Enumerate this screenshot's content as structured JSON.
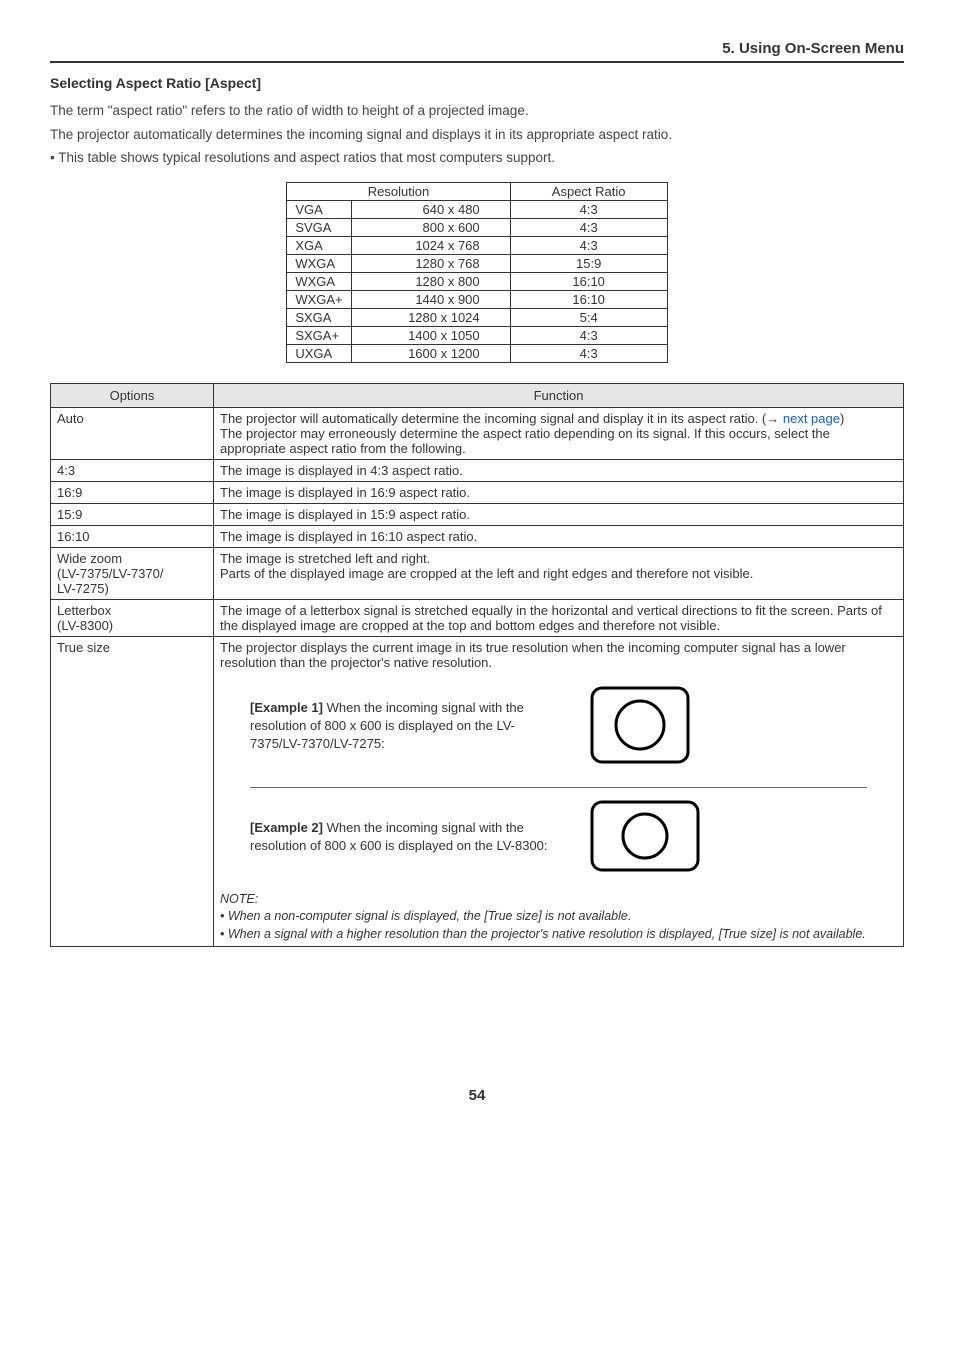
{
  "header": {
    "section": "5. Using On-Screen Menu"
  },
  "heading": "Selecting Aspect Ratio [Aspect]",
  "intro": {
    "p1": "The term \"aspect ratio\" refers to the ratio of width to height of a projected image.",
    "p2": "The projector automatically determines the incoming signal and displays it in its appropriate aspect ratio.",
    "p3": "• This table shows typical resolutions and aspect ratios that most computers support."
  },
  "resTable": {
    "head": {
      "res": "Resolution",
      "ar": "Aspect Ratio"
    },
    "rows": [
      {
        "code": "VGA",
        "res": "640 x 480",
        "ar": "4:3"
      },
      {
        "code": "SVGA",
        "res": "800 x 600",
        "ar": "4:3"
      },
      {
        "code": "XGA",
        "res": "1024 x 768",
        "ar": "4:3"
      },
      {
        "code": "WXGA",
        "res": "1280 x 768",
        "ar": "15:9"
      },
      {
        "code": "WXGA",
        "res": "1280 x 800",
        "ar": "16:10"
      },
      {
        "code": "WXGA+",
        "res": "1440 x 900",
        "ar": "16:10"
      },
      {
        "code": "SXGA",
        "res": "1280 x 1024",
        "ar": "5:4"
      },
      {
        "code": "SXGA+",
        "res": "1400 x 1050",
        "ar": "4:3"
      },
      {
        "code": "UXGA",
        "res": "1600 x 1200",
        "ar": "4:3"
      }
    ]
  },
  "optsTable": {
    "head": {
      "opt": "Options",
      "fn": "Function"
    },
    "auto": {
      "label": "Auto",
      "p1a": "The projector will automatically determine the incoming signal and display it in its aspect ratio. (→ ",
      "link": "next page",
      "p1b": ")",
      "p2": "The projector may erroneously determine the aspect ratio depending on its signal. If this occurs, select the appropriate aspect ratio from the following."
    },
    "r43": {
      "label": "4:3",
      "fn": "The image is displayed in 4:3 aspect ratio."
    },
    "r169": {
      "label": "16:9",
      "fn": "The image is displayed in 16:9 aspect ratio."
    },
    "r159": {
      "label": "15:9",
      "fn": "The image is displayed in 15:9 aspect ratio."
    },
    "r1610": {
      "label": "16:10",
      "fn": "The image is displayed in 16:10 aspect ratio."
    },
    "wide": {
      "label": "Wide zoom\n(LV-7375/LV-7370/\nLV-7275)",
      "l1": "Wide zoom",
      "l2": "(LV-7375/LV-7370/",
      "l3": "LV-7275)",
      "fn1": "The image is stretched left and right.",
      "fn2": "Parts of the displayed image are cropped at the left and right edges and therefore not visible."
    },
    "letter": {
      "l1": "Letterbox",
      "l2": "(LV-8300)",
      "fn": "The image of a letterbox signal is stretched equally in the horizontal and vertical directions to fit the screen. Parts of the displayed image are cropped at the top and bottom edges and therefore not visible."
    },
    "truesize": {
      "label": "True size",
      "intro": "The projector displays the current image in its true resolution when the incoming computer signal has a lower resolution than the projector's native resolution.",
      "ex1": {
        "title": "[Example 1]",
        "body": " When the incoming signal with the resolution of 800 x 600 is displayed on the LV-7375/LV-7370/LV-7275:"
      },
      "ex2": {
        "title": "[Example 2]",
        "body": " When the incoming signal with the resolution of 800 x 600 is displayed on the LV-8300:"
      },
      "note": {
        "title": "NOTE:",
        "n1": "•  When a non-computer signal is displayed, the [True size] is not available.",
        "n2": "•  When a signal with a higher resolution than the projector's native resolution is displayed, [True size] is not available."
      }
    }
  },
  "pageNumber": "54"
}
